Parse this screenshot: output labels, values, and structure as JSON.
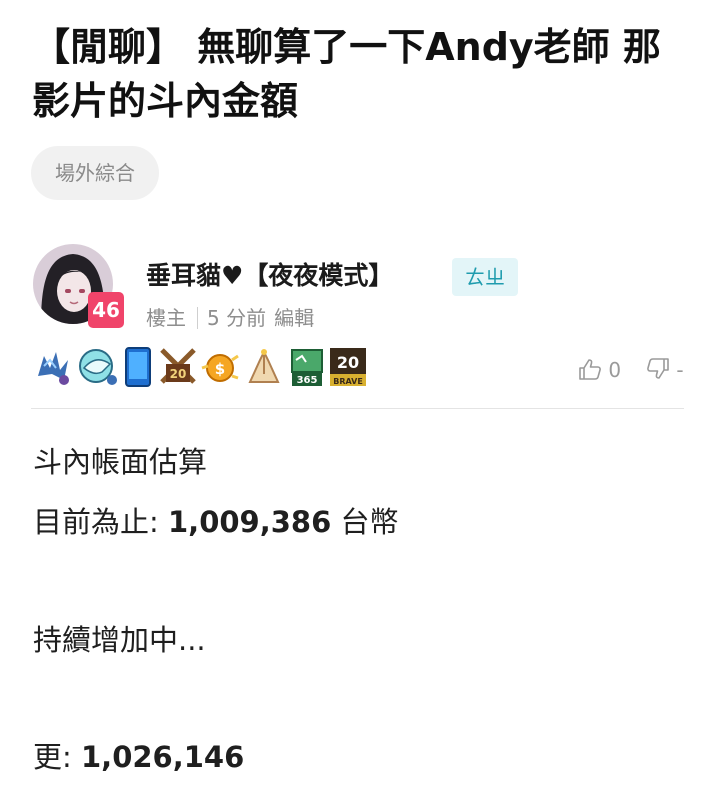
{
  "post": {
    "title": "【閒聊】 無聊算了一下Andy老師 那影片的斗內金額",
    "tag": "場外綜合"
  },
  "author": {
    "name": "垂耳貓♥【夜夜模式】",
    "id_badge": "ㄊㄓ",
    "level": "46",
    "role": "樓主",
    "time": "5 分前",
    "edit_label": "編輯"
  },
  "badges": [
    "dragon-badge-icon",
    "bird-badge-icon",
    "phone-badge-icon",
    "swords-20-badge-icon",
    "coin-badge-icon",
    "hands-badge-icon",
    "flag-365-badge-icon",
    "brave-20-badge-icon"
  ],
  "votes": {
    "up": "0",
    "down": "-"
  },
  "content": {
    "line1": "斗內帳面估算",
    "line2_label": "目前為止:",
    "line2_value": "1,009,386",
    "line2_unit": "台幣",
    "line3": "持續增加中...",
    "line4_label": "更:",
    "line4_value": "1,026,146"
  },
  "colors": {
    "level_badge": "#f0446a",
    "id_badge_bg": "#e3f5f8",
    "id_badge_text": "#1f9cae"
  }
}
